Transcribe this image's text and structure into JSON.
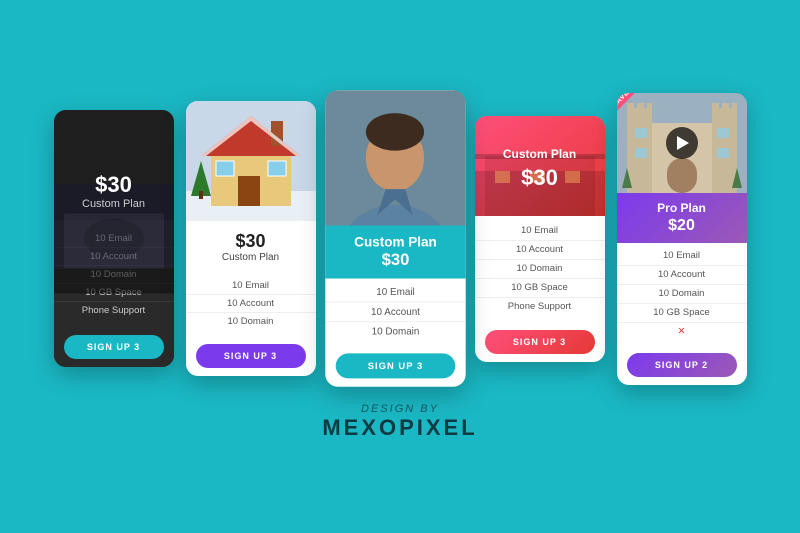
{
  "cards": [
    {
      "id": "card-1",
      "plan": "Custom Plan",
      "price": "$30",
      "features": [
        "10 Email",
        "10 Account",
        "10 Domain",
        "10 GB Space",
        "Phone Support"
      ],
      "btn_label": "SIGN UP 3",
      "btn_color": "#1ab8c4",
      "style": "dark"
    },
    {
      "id": "card-2",
      "plan": "Custom Plan",
      "price": "$30",
      "features": [
        "10 Email",
        "10 Account",
        "10 Domain"
      ],
      "btn_label": "SIGN UP 3",
      "btn_color": "#7c3aed",
      "style": "white-house"
    },
    {
      "id": "card-3",
      "plan": "Custom Plan",
      "price": "$30",
      "features": [
        "10 Email",
        "10 Account",
        "10 Domain"
      ],
      "btn_label": "SIGN UP 3",
      "btn_color": "#1ab8c4",
      "style": "teal-portrait"
    },
    {
      "id": "card-4",
      "plan": "Custom Plan",
      "price": "$30",
      "features": [
        "10 Email",
        "10 Account",
        "10 Domain",
        "10 GB Space",
        "Phone Support"
      ],
      "btn_label": "SIGN UP 3",
      "btn_color": "#e53935",
      "style": "pink-gradient"
    },
    {
      "id": "card-5",
      "plan": "Pro Plan",
      "price": "$20",
      "features": [
        "10 Email",
        "10 Account",
        "10 Domain",
        "10 GB Space",
        "✕"
      ],
      "btn_label": "SIGN UP 2",
      "btn_color": "#7c3aed",
      "style": "purple-house"
    }
  ],
  "footer": {
    "by_text": "DESIGN BY",
    "brand_name": "MEXOPIXEL"
  }
}
